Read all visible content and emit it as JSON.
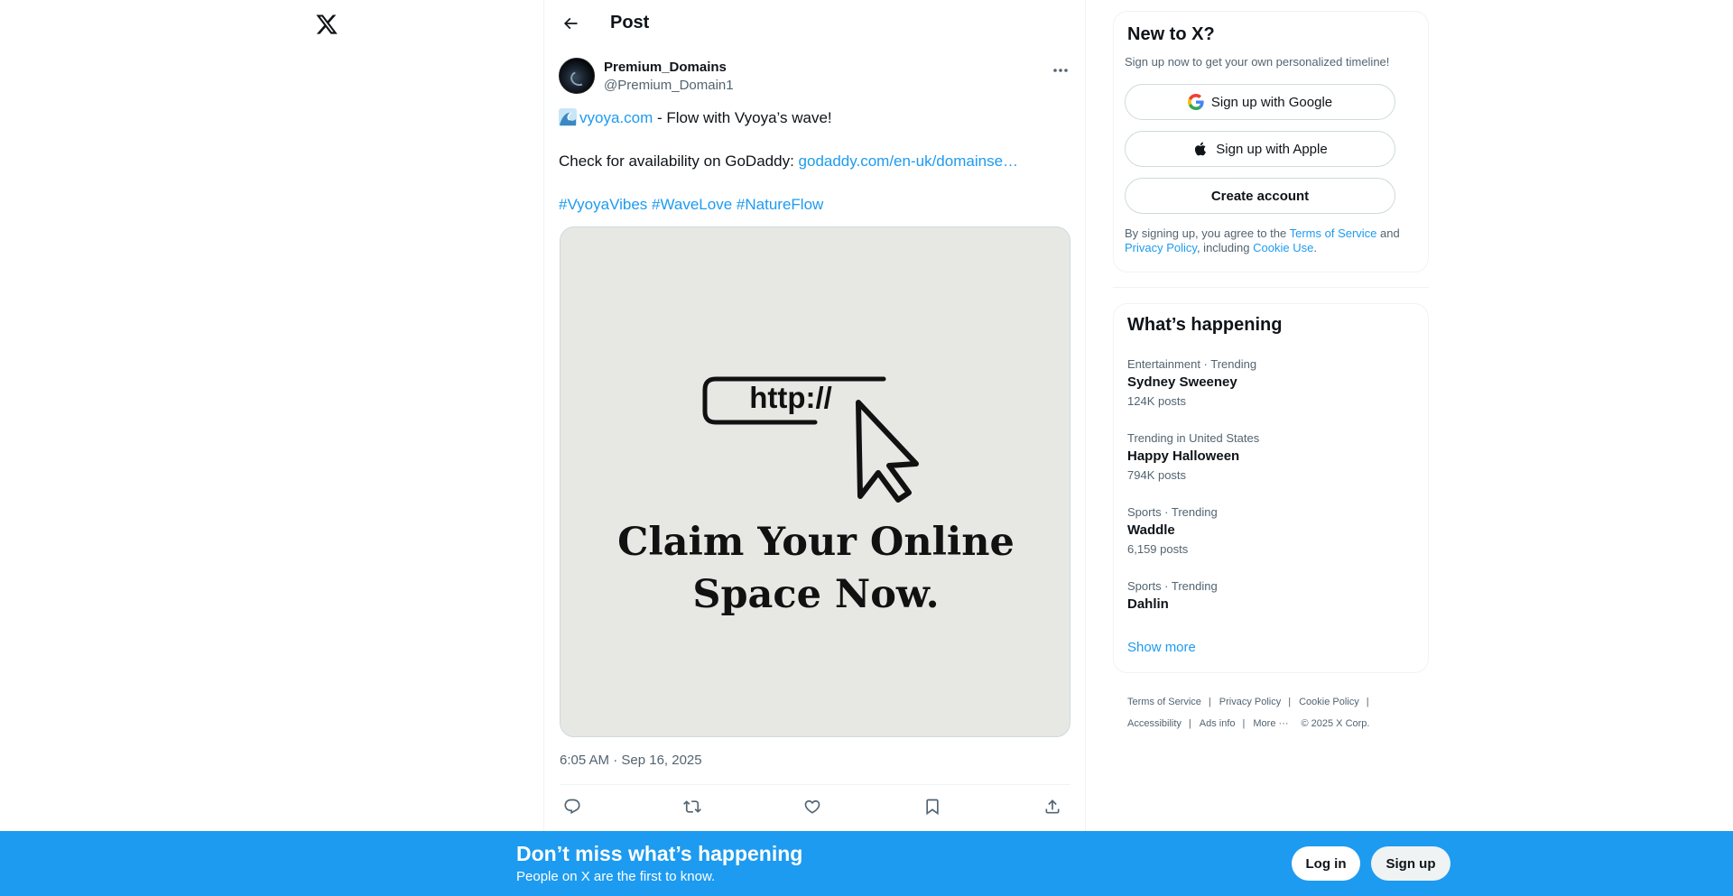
{
  "nav": {
    "logo": "x-logo"
  },
  "header": {
    "back_icon": "arrow-left-icon",
    "title": "Post"
  },
  "post": {
    "author_name": "Premium_Domains",
    "author_handle": "@Premium_Domain1",
    "line1_link": "vyoya.com",
    "line1_rest": " - Flow with Vyoya’s wave!",
    "line2_text": "Check for availability on GoDaddy: ",
    "line2_link": "godaddy.com/en-uk/domainse…",
    "hashtags": [
      "#VyoyaVibes",
      "#WaveLove",
      "#NatureFlow"
    ],
    "image": {
      "url_text": "http://",
      "headline_1": "Claim Your Online",
      "headline_2": "Space Now."
    },
    "timestamp": "6:05 AM · Sep 16, 2025",
    "actions": [
      "reply-icon",
      "repost-icon",
      "like-icon",
      "bookmark-icon",
      "share-icon"
    ]
  },
  "signup": {
    "title": "New to X?",
    "subtitle": "Sign up now to get your own personalized timeline!",
    "google_label": "Sign up with Google",
    "apple_label": "Sign up with Apple",
    "create_label": "Create account",
    "legal_1": "By signing up, you agree to the ",
    "terms": "Terms of Service",
    "and": " and",
    "privacy": "Privacy Policy",
    "including": ", including ",
    "cookie": "Cookie Use",
    "period": "."
  },
  "trends": {
    "title": "What’s happening",
    "items": [
      {
        "meta": "Entertainment · Trending",
        "name": "Sydney Sweeney",
        "count": "124K posts"
      },
      {
        "meta": "Trending in United States",
        "name": "Happy Halloween",
        "count": "794K posts"
      },
      {
        "meta": "Sports · Trending",
        "name": "Waddle",
        "count": "6,159 posts"
      },
      {
        "meta": "Sports · Trending",
        "name": "Dahlin",
        "count": ""
      }
    ],
    "show_more": "Show more"
  },
  "footer": {
    "terms": "Terms of Service",
    "privacy": "Privacy Policy",
    "cookie": "Cookie Policy",
    "accessibility": "Accessibility",
    "ads": "Ads info",
    "more": "More ···",
    "copyright": "© 2025 X Corp."
  },
  "bottom_bar": {
    "title": "Don’t miss what’s happening",
    "subtitle": "People on X are the first to know.",
    "login": "Log in",
    "signup": "Sign up"
  },
  "colors": {
    "accent": "#1d9bf0",
    "text": "#0f1419",
    "muted": "#536471"
  }
}
